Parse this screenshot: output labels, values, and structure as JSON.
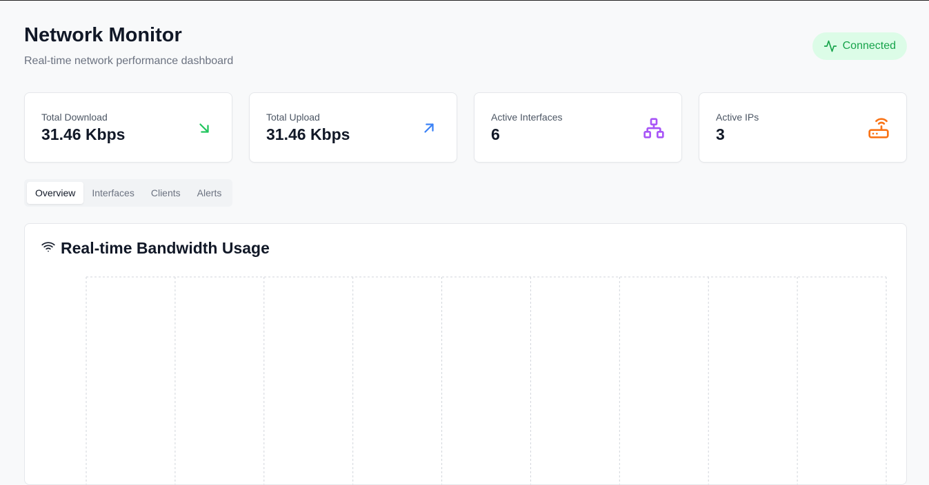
{
  "header": {
    "title": "Network Monitor",
    "subtitle": "Real-time network performance dashboard"
  },
  "status": {
    "label": "Connected",
    "icon": "activity-icon",
    "color": "#16a34a"
  },
  "stats": [
    {
      "label": "Total Download",
      "value": "31.46 Kbps",
      "icon": "arrow-down-right-icon",
      "color": "#22c55e"
    },
    {
      "label": "Total Upload",
      "value": "31.46 Kbps",
      "icon": "arrow-up-right-icon",
      "color": "#3b82f6"
    },
    {
      "label": "Active Interfaces",
      "value": "6",
      "icon": "network-icon",
      "color": "#a855f7"
    },
    {
      "label": "Active IPs",
      "value": "3",
      "icon": "router-icon",
      "color": "#f97316"
    }
  ],
  "tabs": [
    {
      "label": "Overview",
      "active": true
    },
    {
      "label": "Interfaces",
      "active": false
    },
    {
      "label": "Clients",
      "active": false
    },
    {
      "label": "Alerts",
      "active": false
    }
  ],
  "bandwidth_panel": {
    "title": "Real-time Bandwidth Usage",
    "icon": "wifi-icon"
  }
}
